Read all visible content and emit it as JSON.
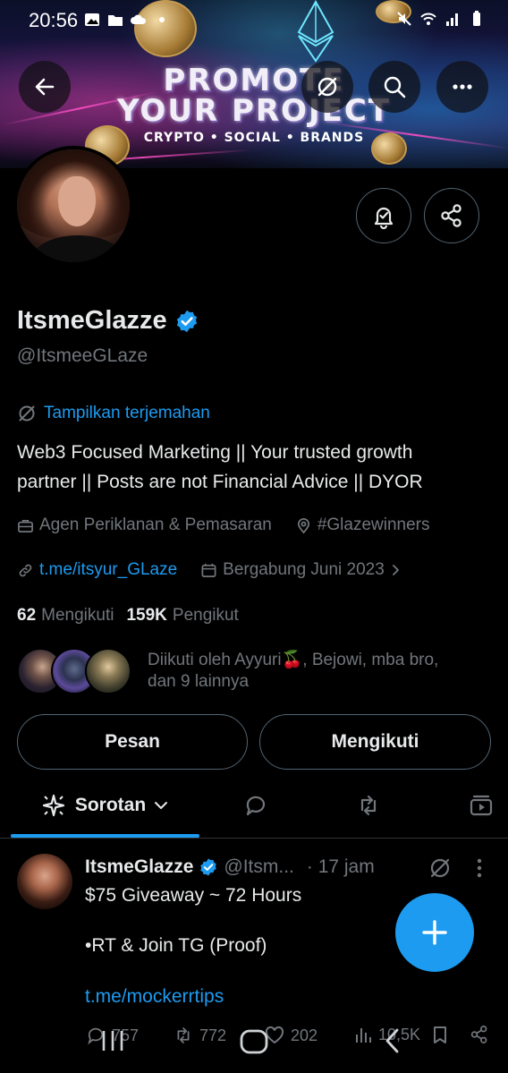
{
  "status_bar": {
    "time": "20:56"
  },
  "banner": {
    "title_line1": "PROMOTE",
    "title_line2": "YOUR PROJECT",
    "subtitle": "CRYPTO • SOCIAL • BRANDS"
  },
  "header_icons": [
    "back-arrow-icon",
    "translate-icon",
    "search-icon",
    "more-icon"
  ],
  "profile": {
    "name": "ItsmeGlazze",
    "handle": "@ItsmeeGLaze",
    "translate_label": "Tampilkan terjemahan",
    "bio_line1": "Web3 Focused Marketing || Your trusted growth",
    "bio_line2": "partner || Posts are not Financial Advice || DYOR",
    "category": "Agen Periklanan & Pemasaran",
    "location": "#Glazewinners",
    "link": "t.me/itsyur_GLaze",
    "joined": "Bergabung Juni 2023",
    "following_count": "62",
    "following_label": "Mengikuti",
    "followers_count": "159K",
    "followers_label": "Pengikut",
    "followed_by_line1": "Diikuti oleh Ayyuri🍒, Bejowi, mba bro,",
    "followed_by_line2": "dan 9 lainnya"
  },
  "buttons": {
    "message": "Pesan",
    "following": "Mengikuti"
  },
  "tabs": {
    "active": "Sorotan"
  },
  "post": {
    "name": "ItsmeGlazze",
    "handle": "@Itsm...",
    "time": "· 17 jam",
    "line1": "$75 Giveaway ~ 72 Hours",
    "line2": "•RT & Join TG (Proof)",
    "link": "t.me/mockerrtips",
    "replies": "757",
    "reposts": "772",
    "likes": "202",
    "views": "10,5K"
  },
  "colors": {
    "accent": "#1d9bf0",
    "background": "#000000",
    "text_primary": "#e7e9ea",
    "text_secondary": "#71767b",
    "border": "#536471"
  }
}
